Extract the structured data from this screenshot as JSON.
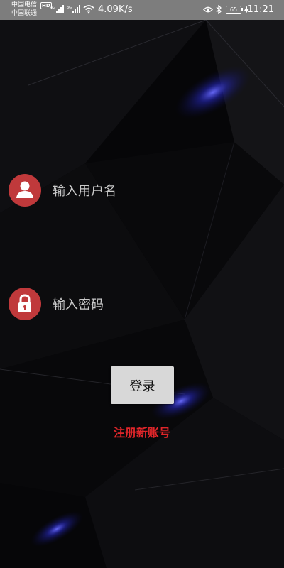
{
  "status_bar": {
    "carrier_primary": "中国电信",
    "carrier_secondary": "中国联通",
    "hd_badge": "HD",
    "net_speed": "4.09K/s",
    "battery_level": "65",
    "time": "11:21",
    "icons": [
      "signal-4g-icon",
      "signal-3g-icon",
      "wifi-icon",
      "eye-icon",
      "bluetooth-icon",
      "battery-icon",
      "charging-icon"
    ]
  },
  "login_form": {
    "username": {
      "placeholder": "输入用户名",
      "value": "",
      "icon": "user-icon"
    },
    "password": {
      "placeholder": "输入密码",
      "value": "",
      "icon": "lock-icon"
    },
    "login_label": "登录",
    "register_label": "注册新账号"
  },
  "colors": {
    "background": "#050507",
    "icon_circle": "#c0393b",
    "register_text": "#e0262a",
    "button_bg": "#d8d8d8",
    "status_bar": "#7d7d7d"
  }
}
